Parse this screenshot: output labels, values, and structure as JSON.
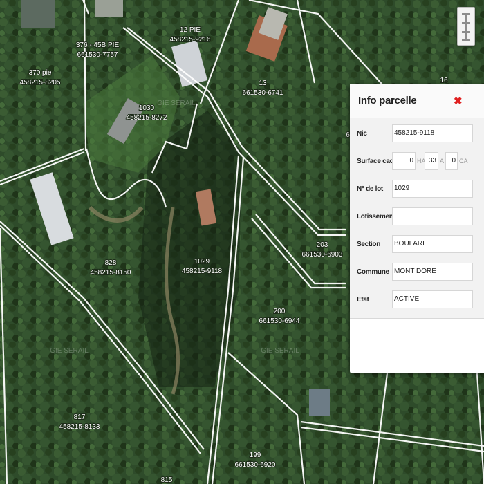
{
  "map": {
    "parcels": [
      {
        "name": "370 pie",
        "nic": "458215-8205"
      },
      {
        "name": "376 - 45B PIE",
        "nic": "661530-7757"
      },
      {
        "name": "12 PIE",
        "nic": "458215-9216"
      },
      {
        "name": "13",
        "nic": "661530-6741"
      },
      {
        "name": "1030",
        "nic": "458215-8272"
      },
      {
        "name": "828",
        "nic": "458215-8150"
      },
      {
        "name": "1029",
        "nic": "458215-9118"
      },
      {
        "name": "203",
        "nic": "661530-6903"
      },
      {
        "name": "200",
        "nic": "661530-6944"
      },
      {
        "name": "817",
        "nic": "458215-8133"
      },
      {
        "name": "199",
        "nic": "661530-6920"
      },
      {
        "name": "815",
        "nic": ""
      },
      {
        "name": "16",
        "nic": ""
      },
      {
        "name": "6",
        "nic": ""
      }
    ],
    "watermark": "GIE SERAIL"
  },
  "layer_switcher": {
    "icon": "layers-icon"
  },
  "info_panel": {
    "title": "Info parcelle",
    "close_icon": "close-icon",
    "close_color": "#e02020",
    "fields": {
      "nic": {
        "label": "Nic",
        "value": "458215-9118"
      },
      "surface": {
        "label": "Surface cad",
        "ha": "0",
        "ha_unit": "HA",
        "a": "33",
        "a_unit": "A",
        "ca": "0",
        "ca_unit": "CA"
      },
      "lot": {
        "label": "N° de lot",
        "value": "1029"
      },
      "lotissement": {
        "label": "Lotissement",
        "value": ""
      },
      "section": {
        "label": "Section",
        "value": "BOULARI"
      },
      "commune": {
        "label": "Commune",
        "value": "MONT DORE"
      },
      "etat": {
        "label": "Etat",
        "value": "ACTIVE"
      }
    }
  }
}
